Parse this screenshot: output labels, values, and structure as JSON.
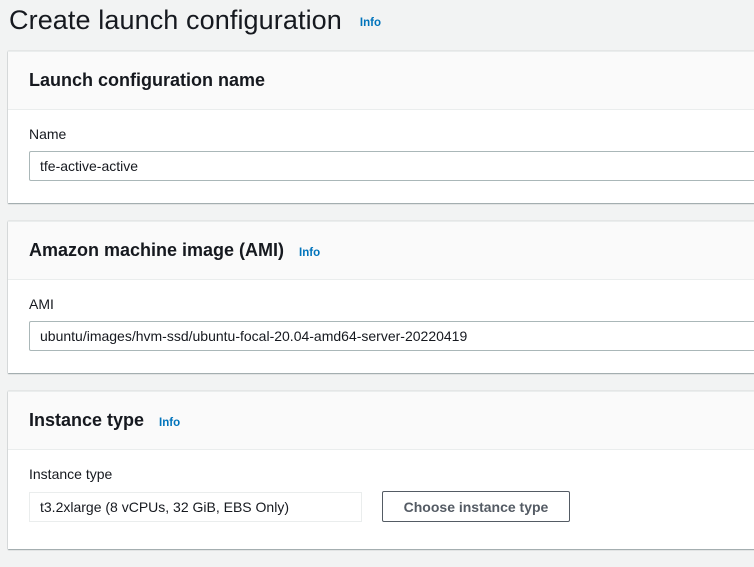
{
  "page": {
    "title": "Create launch configuration",
    "info_label": "Info"
  },
  "launch_config_panel": {
    "title": "Launch configuration name",
    "name_label": "Name",
    "name_value": "tfe-active-active"
  },
  "ami_panel": {
    "title": "Amazon machine image (AMI)",
    "info_label": "Info",
    "ami_label": "AMI",
    "ami_value": "ubuntu/images/hvm-ssd/ubuntu-focal-20.04-amd64-server-20220419"
  },
  "instance_type_panel": {
    "title": "Instance type",
    "info_label": "Info",
    "field_label": "Instance type",
    "selected_value": "t3.2xlarge (8 vCPUs, 32 GiB, EBS Only)",
    "choose_button_label": "Choose instance type"
  },
  "colors": {
    "background": "#f2f3f3",
    "info_link": "#0073bb",
    "panel_header": "#fafafa",
    "text": "#16191f",
    "button_border": "#545b64"
  }
}
